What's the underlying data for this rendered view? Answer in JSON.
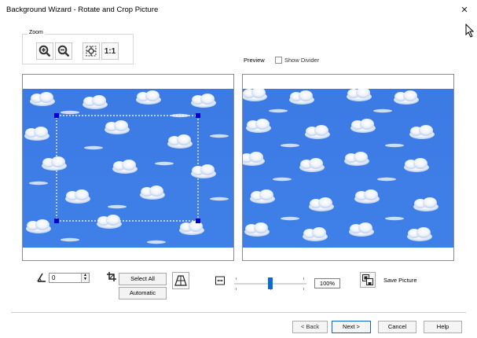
{
  "window": {
    "title": "Background Wizard - Rotate and Crop Picture",
    "close_label": "×"
  },
  "zoom": {
    "label": "Zoom",
    "one_to_one_label": "1:1",
    "buttons": [
      "zoom-in-icon",
      "zoom-out-icon",
      "fit-to-window-icon",
      "one-to-one"
    ]
  },
  "preview": {
    "label": "Preview",
    "show_divider_label": "Show Divider",
    "show_divider_checked": false
  },
  "rotate": {
    "value": "0"
  },
  "crop": {
    "select_all_label": "Select All",
    "automatic_label": "Automatic"
  },
  "width": {
    "percent_label": "100%",
    "slider_fraction": 0.5
  },
  "save": {
    "label": "Save Picture"
  },
  "footer": {
    "back_label": "< Back",
    "next_label": "Next >",
    "cancel_label": "Cancel",
    "help_label": "Help"
  },
  "colors": {
    "sky": "#3e7de6",
    "crop_handle": "#0000cc",
    "accent": "#0a6ad8"
  }
}
